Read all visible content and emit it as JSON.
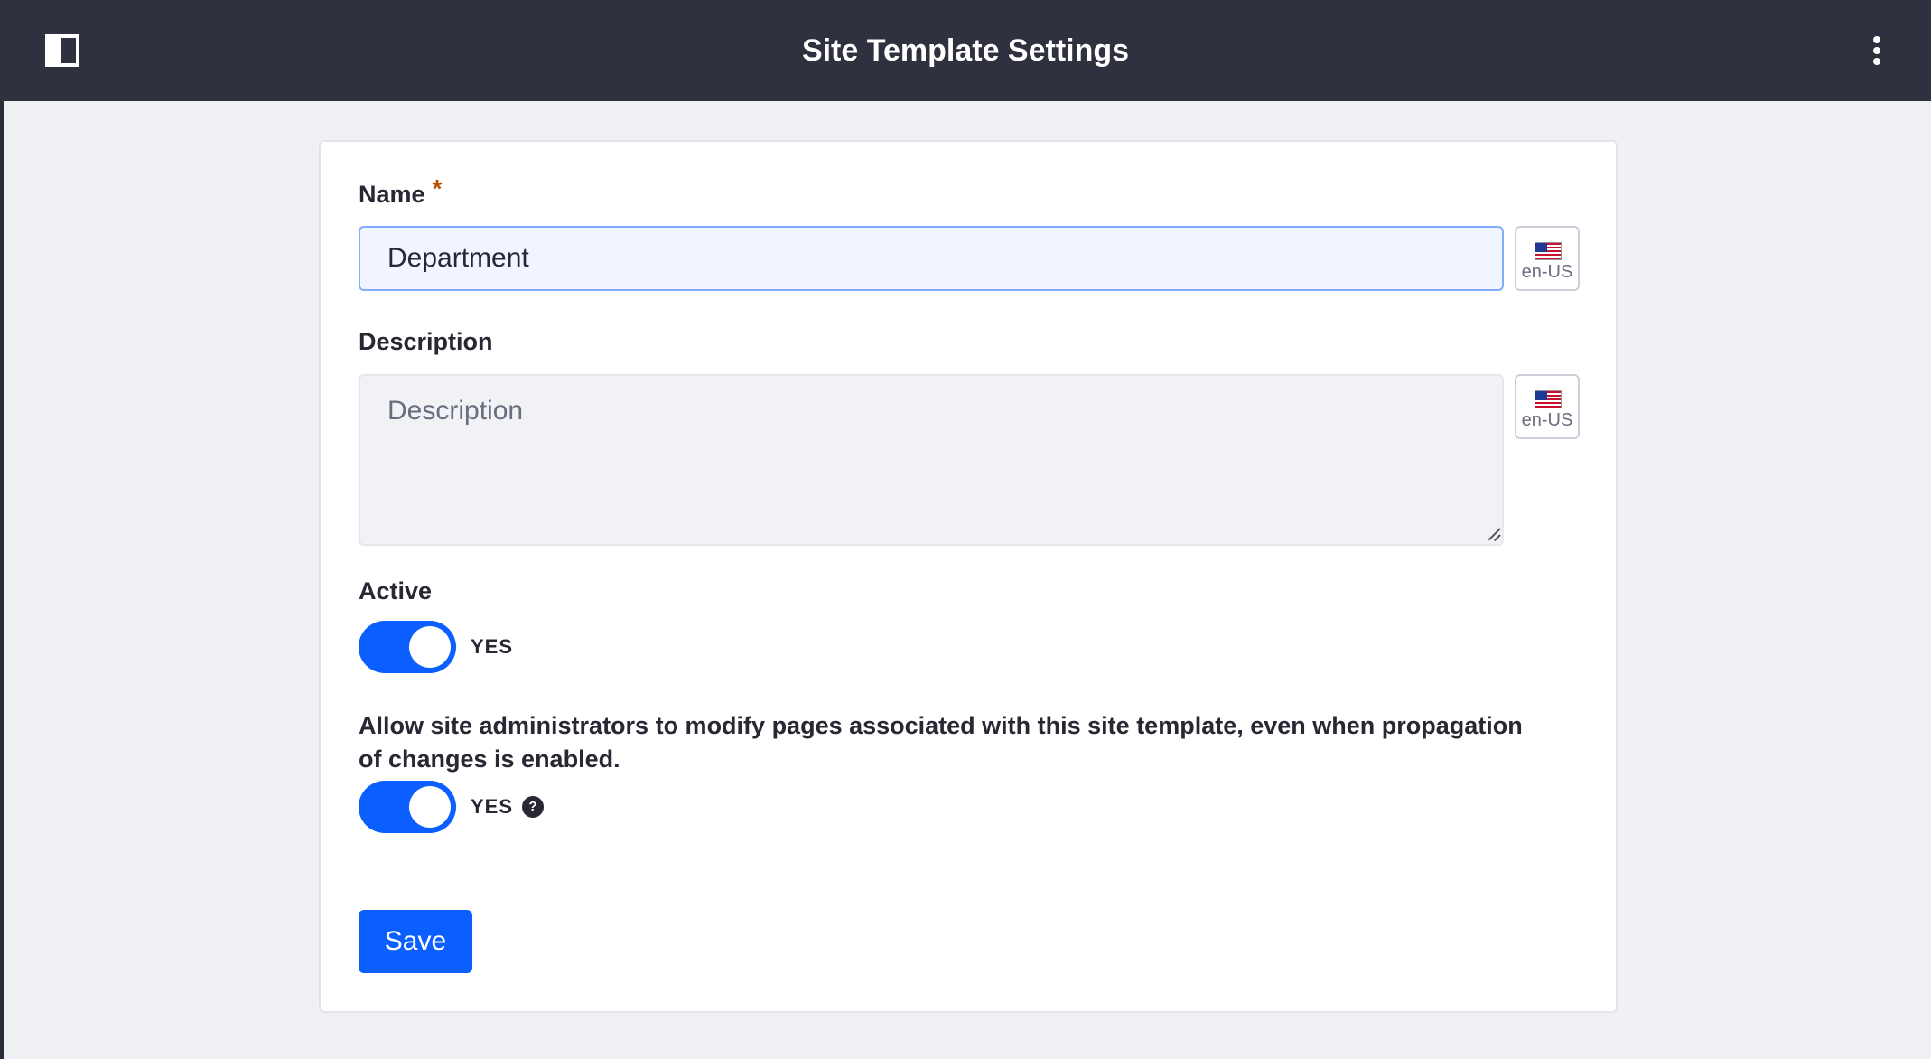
{
  "header": {
    "title": "Site Template Settings",
    "left_icon": "panel-toggle-icon",
    "right_icon": "kebab-menu-icon"
  },
  "form": {
    "name": {
      "label": "Name",
      "required_marker": "*",
      "value": "Department",
      "locale": "en-US"
    },
    "description": {
      "label": "Description",
      "placeholder": "Description",
      "value": "",
      "locale": "en-US"
    },
    "active": {
      "label": "Active",
      "state_text": "YES",
      "checked": true
    },
    "allow_modify": {
      "label": "Allow site administrators to modify pages associated with this site template, even when propagation of changes is enabled.",
      "state_text": "YES",
      "checked": true,
      "help_icon_glyph": "?"
    },
    "save_label": "Save"
  },
  "colors": {
    "topbar": "#30313f",
    "primary": "#0b5fff",
    "required": "#b95000"
  }
}
